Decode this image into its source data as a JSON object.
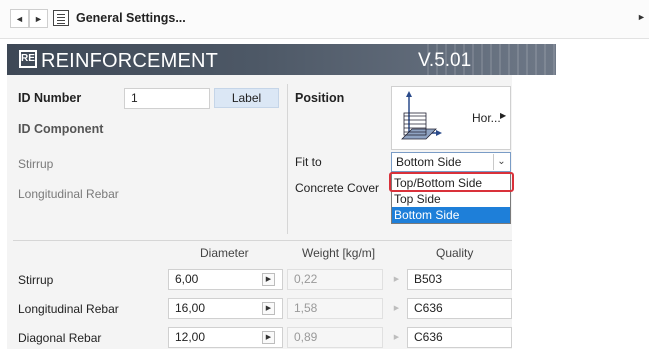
{
  "toolbar": {
    "back_icon": "◄",
    "forward_icon": "►",
    "title": "General Settings...",
    "scroll_icon": "►"
  },
  "banner": {
    "logo": "RE",
    "brand": "REINFORCEMENT",
    "version": "V.5.01"
  },
  "id_section": {
    "id_number_label": "ID Number",
    "id_number_value": "1",
    "label_button": "Label",
    "id_component_label": "ID Component",
    "stirrup_label": "Stirrup",
    "longitudinal_label": "Longitudinal Rebar"
  },
  "position": {
    "title": "Position",
    "button_label": "Hor...",
    "fit_to_label": "Fit to",
    "fit_to_value": "Bottom Side",
    "concrete_cover_label": "Concrete Cover",
    "options": [
      "Top/Bottom Side",
      "Top Side",
      "Bottom Side"
    ],
    "selected_option": "Bottom Side"
  },
  "table": {
    "headers": [
      "Diameter",
      "Weight [kg/m]",
      "Quality"
    ],
    "rows": [
      {
        "name": "Stirrup",
        "diameter": "6,00",
        "weight": "0,22",
        "quality": "B503"
      },
      {
        "name": "Longitudinal Rebar",
        "diameter": "16,00",
        "weight": "1,58",
        "quality": "C636"
      },
      {
        "name": "Diagonal Rebar",
        "diameter": "12,00",
        "weight": "0,89",
        "quality": "C636"
      }
    ]
  },
  "colors": {
    "banner": "#4d5866",
    "selection": "#1e7fd9",
    "highlight": "#d9313a",
    "label_button": "#dbe7f5"
  }
}
